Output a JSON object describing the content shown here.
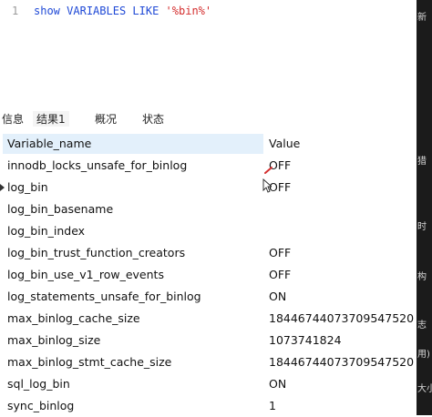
{
  "editor": {
    "line_number": "1",
    "kw_show": "show",
    "kw_variables": "VARIABLES",
    "kw_like": "LIKE",
    "pattern": "'%bin%'"
  },
  "tabs": [
    {
      "label": "信息"
    },
    {
      "label": "结果1"
    },
    {
      "label": "概况"
    },
    {
      "label": "状态"
    }
  ],
  "grid": {
    "col_name": "Variable_name",
    "col_value": "Value",
    "rows": [
      {
        "name": "innodb_locks_unsafe_for_binlog",
        "value": "OFF"
      },
      {
        "name": "log_bin",
        "value": "OFF"
      },
      {
        "name": "log_bin_basename",
        "value": ""
      },
      {
        "name": "log_bin_index",
        "value": ""
      },
      {
        "name": "log_bin_trust_function_creators",
        "value": "OFF"
      },
      {
        "name": "log_bin_use_v1_row_events",
        "value": "OFF"
      },
      {
        "name": "log_statements_unsafe_for_binlog",
        "value": "ON"
      },
      {
        "name": "max_binlog_cache_size",
        "value": "18446744073709547520"
      },
      {
        "name": "max_binlog_size",
        "value": "1073741824"
      },
      {
        "name": "max_binlog_stmt_cache_size",
        "value": "18446744073709547520"
      },
      {
        "name": "sql_log_bin",
        "value": "ON"
      },
      {
        "name": "sync_binlog",
        "value": "1"
      }
    ]
  },
  "side_fragments": [
    "新",
    "猎",
    "时",
    "构",
    "志",
    "用)",
    "大小"
  ],
  "colors": {
    "keyword": "#1f49d6",
    "string": "#d42f2f",
    "header_bg": "#e3f0fb"
  }
}
